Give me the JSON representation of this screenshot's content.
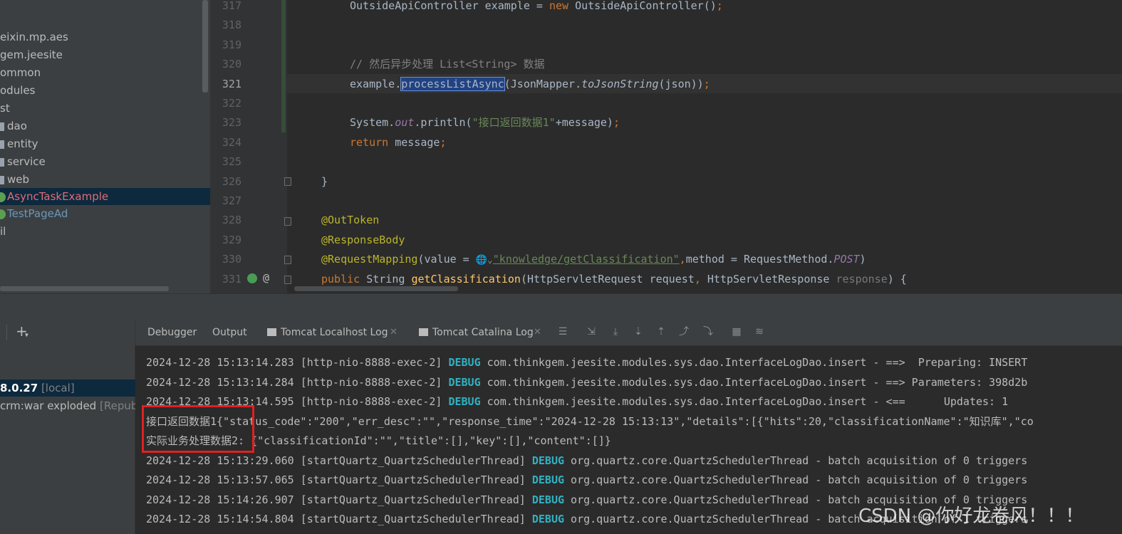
{
  "project_tree": {
    "items": [
      {
        "label": "eixin.mp.aes"
      },
      {
        "label": "gem.jeesite"
      },
      {
        "label": "ommon"
      },
      {
        "label": "odules"
      },
      {
        "label": "st"
      },
      {
        "label": "dao"
      },
      {
        "label": "entity"
      },
      {
        "label": "service"
      },
      {
        "label": "web"
      },
      {
        "label": "AsyncTaskExample",
        "selected": true,
        "color": "#e06c75"
      },
      {
        "label": "TestPageAd",
        "color": "#6897bb"
      },
      {
        "label": "il"
      }
    ]
  },
  "editor": {
    "line_numbers": [
      "317",
      "318",
      "319",
      "320",
      "321",
      "322",
      "323",
      "324",
      "325",
      "326",
      "327",
      "328",
      "329",
      "330",
      "331"
    ],
    "current_line": "321",
    "lines": [
      {
        "n": "317",
        "segments": [
          {
            "t": "OutsideApiController example = ",
            "c": ""
          },
          {
            "t": "new ",
            "c": "kw"
          },
          {
            "t": "OutsideApiController()",
            "c": ""
          },
          {
            "t": ";",
            "c": "kw"
          }
        ]
      },
      {
        "n": "318",
        "segments": []
      },
      {
        "n": "319",
        "segments": []
      },
      {
        "n": "320",
        "segments": [
          {
            "t": "// 然后异步处理 List<String> 数据",
            "c": "cm"
          }
        ]
      },
      {
        "n": "321",
        "segments": [
          {
            "t": "example.",
            "c": ""
          },
          {
            "t": "processListAsync",
            "c": "sel"
          },
          {
            "t": "(JsonMapper.",
            "c": ""
          },
          {
            "t": "toJsonString",
            "c": "st"
          },
          {
            "t": "(json))",
            "c": ""
          },
          {
            "t": ";",
            "c": "kw"
          }
        ]
      },
      {
        "n": "322",
        "segments": []
      },
      {
        "n": "323",
        "segments": [
          {
            "t": "System.",
            "c": ""
          },
          {
            "t": "out",
            "c": "fld"
          },
          {
            "t": ".println(",
            "c": ""
          },
          {
            "t": "\"接口返回数据1\"",
            "c": "str"
          },
          {
            "t": "+message)",
            "c": ""
          },
          {
            "t": ";",
            "c": "kw"
          }
        ]
      },
      {
        "n": "324",
        "segments": [
          {
            "t": "return ",
            "c": "kw"
          },
          {
            "t": "message",
            "c": ""
          },
          {
            "t": ";",
            "c": "kw"
          }
        ]
      },
      {
        "n": "325",
        "segments": []
      },
      {
        "n": "326",
        "segments": [
          {
            "t": "}",
            "c": ""
          }
        ]
      },
      {
        "n": "327",
        "segments": []
      },
      {
        "n": "328",
        "segments": [
          {
            "t": "@OutToken",
            "c": "ann"
          }
        ]
      },
      {
        "n": "329",
        "segments": [
          {
            "t": "@ResponseBody",
            "c": "ann"
          }
        ]
      },
      {
        "n": "330",
        "segments": [
          {
            "t": "@RequestMapping",
            "c": "ann"
          },
          {
            "t": "(value = ",
            "c": ""
          },
          {
            "t": "🌐⌄",
            "c": "globe"
          },
          {
            "t": "\"knowledge/getClassification\"",
            "c": "link"
          },
          {
            "t": ",",
            "c": "kw"
          },
          {
            "t": "method = RequestMethod.",
            "c": ""
          },
          {
            "t": "POST",
            "c": "fld"
          },
          {
            "t": ")",
            "c": ""
          }
        ]
      },
      {
        "n": "331",
        "segments": [
          {
            "t": "public ",
            "c": "kw"
          },
          {
            "t": "String ",
            "c": ""
          },
          {
            "t": "getClassification",
            "c": "fn"
          },
          {
            "t": "(HttpServletRequest request",
            "c": ""
          },
          {
            "t": ", ",
            "c": "kw"
          },
          {
            "t": "HttpServletResponse ",
            "c": ""
          },
          {
            "t": "response",
            "c": "hint"
          },
          {
            "t": ") {",
            "c": ""
          }
        ]
      }
    ],
    "gutter_at_symbol": "@"
  },
  "bottom_panel": {
    "add_button": "+",
    "services": [
      {
        "name": "8.0.27",
        "tag": "[local]"
      },
      {
        "name": "crm:war exploded",
        "tag": "[Republ"
      }
    ],
    "tabs": [
      {
        "label": "Debugger"
      },
      {
        "label": "Output"
      },
      {
        "label": "Tomcat Localhost Log",
        "closable": true
      },
      {
        "label": "Tomcat Catalina Log",
        "closable": true
      }
    ],
    "close_glyph": "✕",
    "log_lines": [
      {
        "segments": [
          {
            "t": "2024-12-28 15:13:14.283 [http-nio-8888-exec-2] ",
            "c": ""
          },
          {
            "t": "DEBUG",
            "c": "debug"
          },
          {
            "t": " com.thinkgem.jeesite.modules.sys.dao.InterfaceLogDao.insert - ==>  Preparing: INSERT",
            "c": ""
          }
        ]
      },
      {
        "segments": [
          {
            "t": "2024-12-28 15:13:14.284 [http-nio-8888-exec-2] ",
            "c": ""
          },
          {
            "t": "DEBUG",
            "c": "debug"
          },
          {
            "t": " com.thinkgem.jeesite.modules.sys.dao.InterfaceLogDao.insert - ==> Parameters: 398d2b",
            "c": ""
          }
        ]
      },
      {
        "segments": [
          {
            "t": "2024-12-28 15:13:14.595 [http-nio-8888-exec-2] ",
            "c": ""
          },
          {
            "t": "DEBUG",
            "c": "debug"
          },
          {
            "t": " com.thinkgem.jeesite.modules.sys.dao.InterfaceLogDao.insert - <==      Updates: 1",
            "c": ""
          }
        ]
      },
      {
        "segments": [
          {
            "t": "接口返回数据1{\"status_code\":\"200\",\"err_desc\":\"\",\"response_time\":\"2024-12-28 15:13:13\",\"details\":[{\"hits\":20,\"classificationName\":\"知识库\",\"co",
            "c": ""
          }
        ]
      },
      {
        "segments": [
          {
            "t": "实际业务处理数据2: {\"classificationId\":\"\",\"title\":[],\"key\":[],\"content\":[]}",
            "c": ""
          }
        ]
      },
      {
        "segments": [
          {
            "t": "2024-12-28 15:13:29.060 [startQuartz_QuartzSchedulerThread] ",
            "c": ""
          },
          {
            "t": "DEBUG",
            "c": "debug"
          },
          {
            "t": " org.quartz.core.QuartzSchedulerThread - batch acquisition of 0 triggers",
            "c": ""
          }
        ]
      },
      {
        "segments": [
          {
            "t": "2024-12-28 15:13:57.065 [startQuartz_QuartzSchedulerThread] ",
            "c": ""
          },
          {
            "t": "DEBUG",
            "c": "debug"
          },
          {
            "t": " org.quartz.core.QuartzSchedulerThread - batch acquisition of 0 triggers",
            "c": ""
          }
        ]
      },
      {
        "segments": [
          {
            "t": "2024-12-28 15:14:26.907 [startQuartz_QuartzSchedulerThread] ",
            "c": ""
          },
          {
            "t": "DEBUG",
            "c": "debug"
          },
          {
            "t": " org.quartz.core.QuartzSchedulerThread - batch acquisition of 0 triggers",
            "c": ""
          }
        ]
      },
      {
        "segments": [
          {
            "t": "2024-12-28 15:14:54.804 [startQuartz_QuartzSchedulerThread] ",
            "c": ""
          },
          {
            "t": "DEBUG",
            "c": "debug"
          },
          {
            "t": " org.quartz.core.QuartzSchedulerThread - batch acquisition of 1 triggers",
            "c": ""
          }
        ]
      }
    ]
  },
  "watermark": "CSDN @你好龙卷风！！！",
  "colors": {
    "editor_bg": "#2b2b2b",
    "panel_bg": "#3c3f41",
    "selection": "#0d293e",
    "keyword": "#cc7832",
    "string": "#6a8759",
    "annotation": "#bbb529",
    "debug": "#2fb2c3",
    "highlight_box": "#e02020"
  }
}
